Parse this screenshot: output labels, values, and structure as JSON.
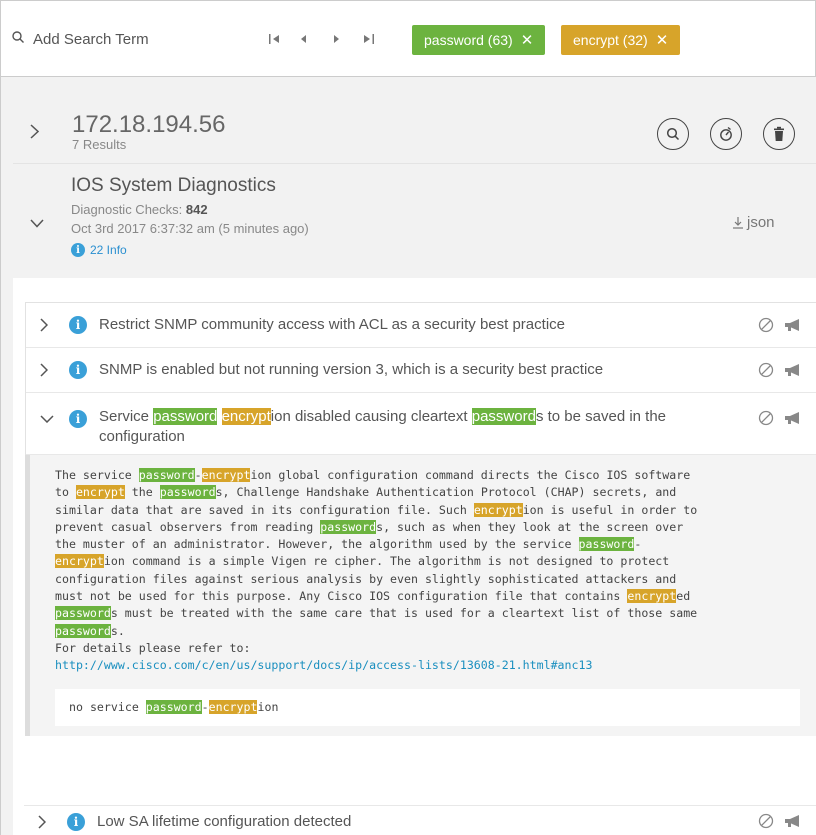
{
  "search": {
    "placeholder": "Add Search Term"
  },
  "tags": [
    {
      "label": "password (63)",
      "color": "#6cb33f"
    },
    {
      "label": "encrypt (32)",
      "color": "#d7a42a"
    }
  ],
  "host": {
    "ip": "172.18.194.56",
    "results": "7 Results"
  },
  "diagnostic": {
    "title": "IOS System Diagnostics",
    "checks_label": "Diagnostic Checks:",
    "checks_value": "842",
    "date": "Oct 3rd 2017 6:37:32 am (5 minutes ago)",
    "info": "22 Info",
    "json_label": "json"
  },
  "issues": [
    {
      "text": "Restrict SNMP community access with ACL as a security best practice"
    },
    {
      "text": "SNMP is enabled but not running version 3, which is a security best practice"
    },
    {
      "text_parts": [
        "Service ",
        "password",
        " ",
        "encrypt",
        "ion disabled causing cleartext ",
        "password",
        "s to be saved in the configuration"
      ]
    },
    {
      "text": "Low SA lifetime configuration detected"
    }
  ],
  "detail": {
    "refer": "For details please refer to:",
    "link": "http://www.cisco.com/c/en/us/support/docs/ip/access-lists/13608-21.html#anc13",
    "code": [
      "no service ",
      "password",
      "-",
      "encrypt",
      "ion"
    ]
  },
  "colors": {
    "password_highlight": "#6cb33f",
    "encrypt_highlight": "#d7a42a",
    "info": "#3aa0d8",
    "link": "#1a8fbf"
  }
}
